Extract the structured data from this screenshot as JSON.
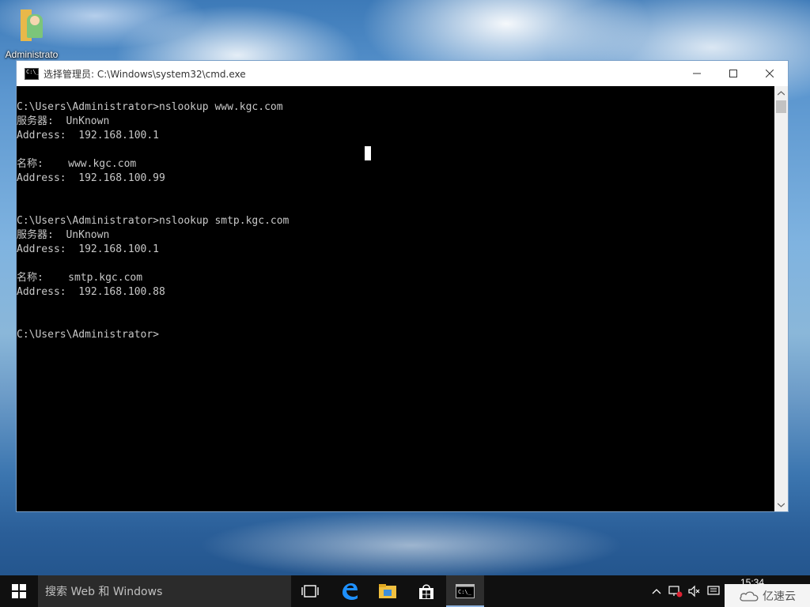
{
  "desktop": {
    "icon_label": "Administrato"
  },
  "window": {
    "title": "选择管理员: C:\\Windows\\system32\\cmd.exe",
    "minimize_symbol": "—",
    "maximize_symbol": "☐",
    "close_symbol": "✕"
  },
  "console": {
    "lines": [
      "",
      "C:\\Users\\Administrator>nslookup www.kgc.com",
      "服务器:  UnKnown",
      "Address:  192.168.100.1",
      "",
      "名称:    www.kgc.com",
      "Address:  192.168.100.99",
      "",
      "",
      "C:\\Users\\Administrator>nslookup smtp.kgc.com",
      "服务器:  UnKnown",
      "Address:  192.168.100.1",
      "",
      "名称:    smtp.kgc.com",
      "Address:  192.168.100.88",
      "",
      "",
      "C:\\Users\\Administrator>"
    ]
  },
  "taskbar": {
    "search_placeholder": "搜索 Web 和 Windows",
    "clock_time": "15:34",
    "icons": [
      "windows-logo-icon",
      "task-view-icon",
      "edge-icon",
      "file-explorer-icon",
      "store-icon",
      "cmd-icon"
    ]
  },
  "watermark": {
    "text": "亿速云"
  },
  "colors": {
    "console_bg": "#000000",
    "console_fg": "#c8c8c8",
    "taskbar_bg": "#101010",
    "search_bg": "#2b2b2b",
    "accent": "#8fb4e0"
  }
}
